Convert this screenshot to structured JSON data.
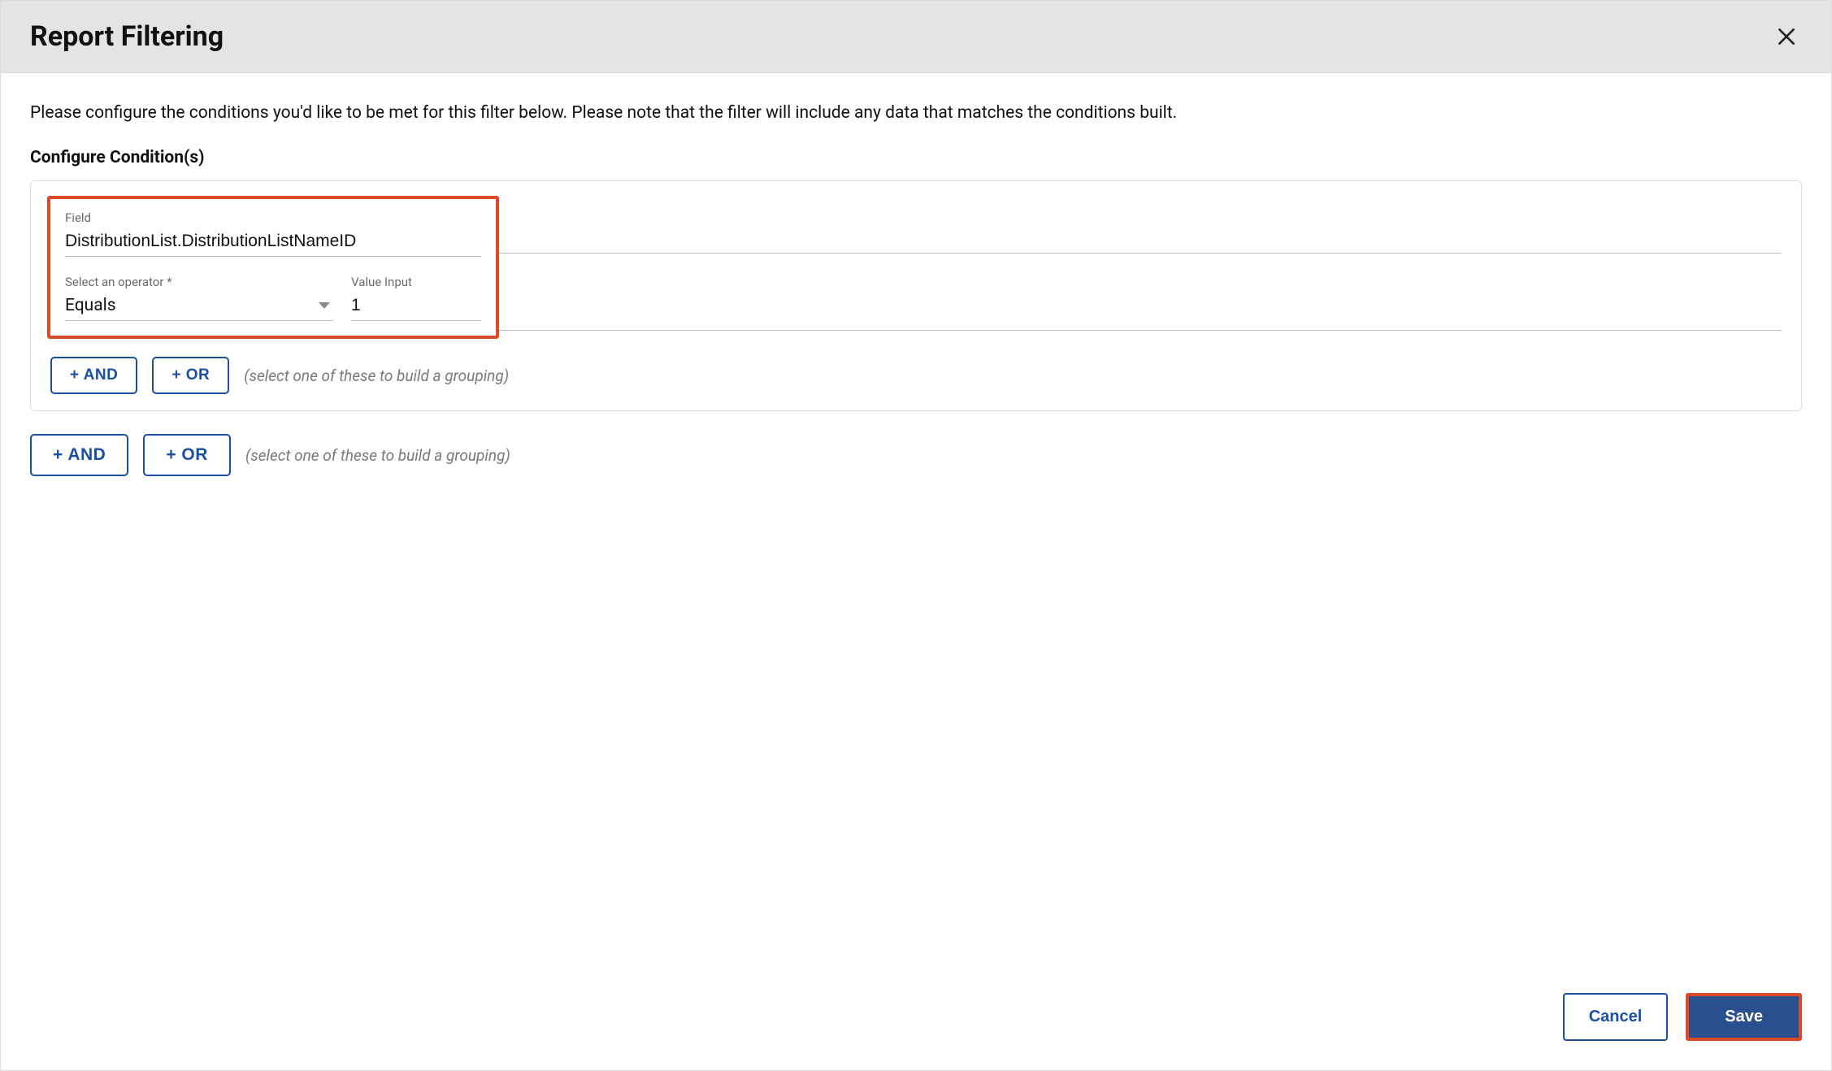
{
  "header": {
    "title": "Report Filtering"
  },
  "body": {
    "instructions": "Please configure the conditions you'd like to be met for this filter below. Please note that the filter will include any data that matches the conditions built.",
    "section_label": "Configure Condition(s)",
    "condition": {
      "field_label": "Field",
      "field_value": "DistributionList.DistributionListNameID",
      "operator_label": "Select an operator *",
      "operator_value": "Equals",
      "value_label": "Value Input",
      "value_value": "1"
    },
    "inner_buttons": {
      "and": "+ AND",
      "or": "+ OR",
      "hint": "(select one of these to build a grouping)"
    },
    "outer_buttons": {
      "and": "+ AND",
      "or": "+ OR",
      "hint": "(select one of these to build a grouping)"
    }
  },
  "footer": {
    "cancel": "Cancel",
    "save": "Save"
  }
}
